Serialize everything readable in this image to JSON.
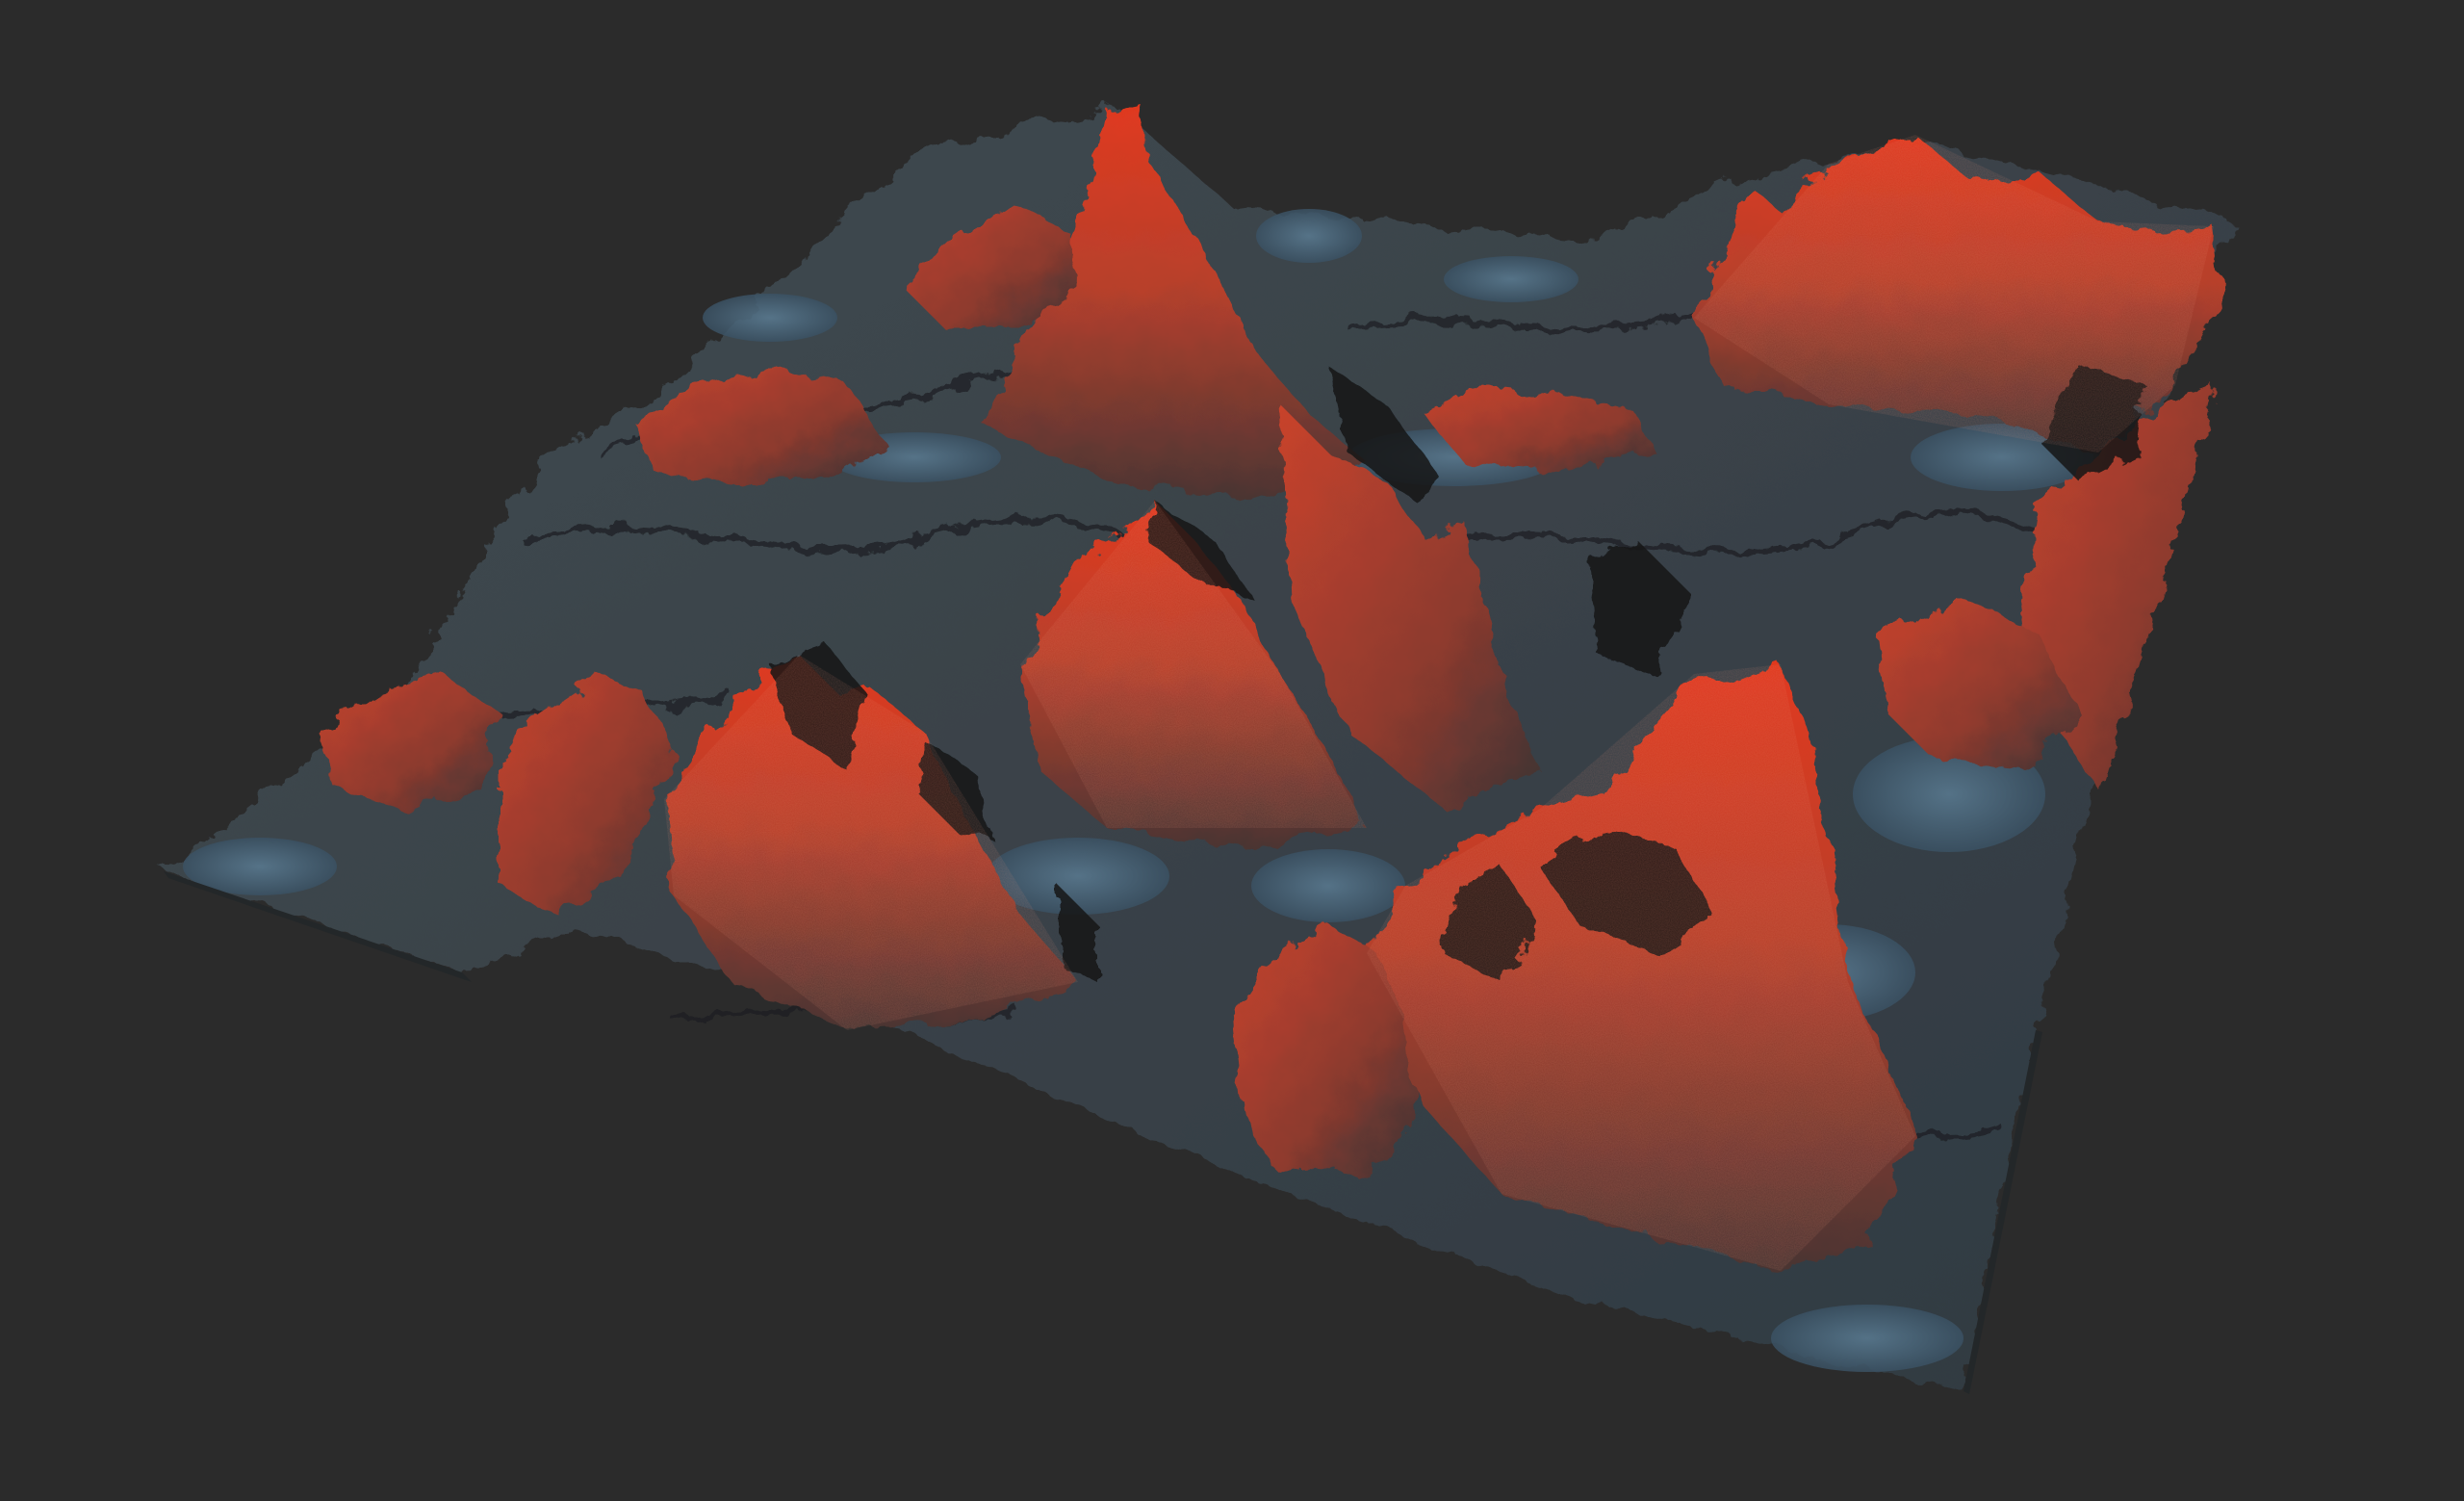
{
  "viewport": {
    "background_color": "#2b2b2b",
    "content": "3d-terrain-heightmap-render"
  },
  "terrain": {
    "colors": {
      "peak_red": "#e0391f",
      "ridge_red": "#b8402c",
      "dark_rock": "#3a3d3e",
      "valley_blue": "#3e5566",
      "water_blue": "#4d6e85",
      "shadow": "#121416"
    }
  }
}
